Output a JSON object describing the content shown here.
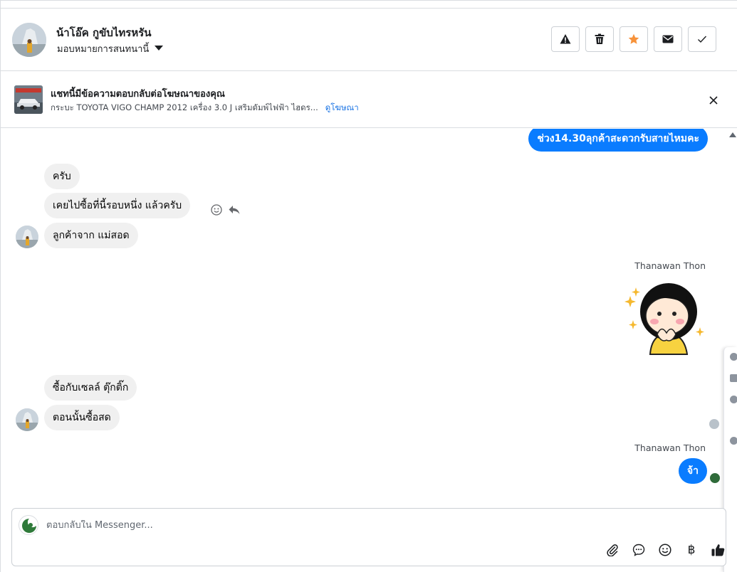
{
  "header": {
    "contact_name": "น้าโอ๊ค กูขับไทรหรัน",
    "assign_label": "มอบหมายการสนทนานี้",
    "actions": [
      {
        "name": "spam-button",
        "icon": "warning-icon"
      },
      {
        "name": "delete-button",
        "icon": "trash-icon"
      },
      {
        "name": "follow-up-button",
        "icon": "star-icon",
        "color": "#f7923a"
      },
      {
        "name": "mark-unread-button",
        "icon": "envelope-icon"
      },
      {
        "name": "mark-done-button",
        "icon": "check-icon"
      }
    ]
  },
  "ad_banner": {
    "title": "แชทนี้มีข้อความตอบกลับต่อโฆษณาของคุณ",
    "description": "กระบะ TOYOTA VIGO CHAMP 2012 เครื่อง 3.0 J เสริมดัมพ์ไฟฟ้า ไฮดร...",
    "link": "ดูโฆษณา"
  },
  "messages": [
    {
      "direction": "outgoing",
      "text": "ช่วง14.30ลุกค้าสะดวกรับสายไหมคะ"
    },
    {
      "direction": "incoming",
      "text": "ครับ"
    },
    {
      "direction": "incoming",
      "text": "เคยไปซื้อที่นี้รอบหนึ่ง แล้วครับ"
    },
    {
      "direction": "incoming",
      "text": "ลูกค้าจาก แม่สอด"
    },
    {
      "direction": "outgoing",
      "sender": "Thanawan Thon",
      "type": "sticker",
      "sticker": "shy-girl-sticker"
    },
    {
      "direction": "incoming",
      "text": "ซื้อกับเซลล์ ตุ๊กติ๊ก"
    },
    {
      "direction": "incoming",
      "text": "ตอนนั้นซื้อสด"
    },
    {
      "direction": "outgoing",
      "sender": "Thanawan Thon",
      "text": "จ้า"
    }
  ],
  "composer": {
    "placeholder": "ตอบกลับใน Messenger...",
    "tools": [
      "paperclip-icon",
      "saved-reply-icon",
      "emoji-icon",
      "baht-icon",
      "thumbs-up-icon"
    ],
    "baht_symbol": "฿"
  },
  "colors": {
    "outgoing_bubble": "#0a7cff",
    "incoming_bubble": "#f0f0f0",
    "link": "#1b74e4",
    "star": "#f7923a"
  }
}
